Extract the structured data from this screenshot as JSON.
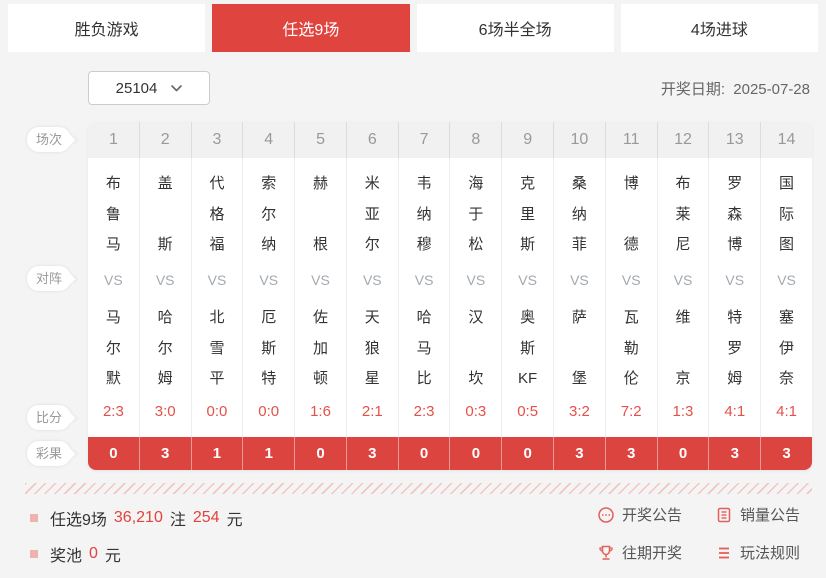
{
  "colors": {
    "accent_red": "#e0443e",
    "result_row_red": "#dc453f",
    "score_red": "#e4504a",
    "icon_red": "#e2605a",
    "page_bg": "#f4f4f4"
  },
  "tabs": [
    {
      "label": "胜负游戏",
      "active": false
    },
    {
      "label": "任选9场",
      "active": true
    },
    {
      "label": "6场半全场",
      "active": false
    },
    {
      "label": "4场进球",
      "active": false
    }
  ],
  "controls": {
    "period_value": "25104",
    "draw_date_label": "开奖日期:",
    "draw_date_value": "2025-07-28"
  },
  "row_labels": {
    "session": "场次",
    "matchup": "对阵",
    "score": "比分",
    "result": "彩果"
  },
  "table": {
    "vs_label": "VS"
  },
  "matches": [
    {
      "no": "1",
      "home": [
        "布",
        "鲁",
        "马"
      ],
      "away": [
        "马",
        "尔",
        "默"
      ],
      "score": "2:3",
      "result": "0"
    },
    {
      "no": "2",
      "home": [
        "盖",
        "斯"
      ],
      "away": [
        "哈",
        "尔",
        "姆"
      ],
      "score": "3:0",
      "result": "3"
    },
    {
      "no": "3",
      "home": [
        "代",
        "格",
        "福"
      ],
      "away": [
        "北",
        "雪",
        "平"
      ],
      "score": "0:0",
      "result": "1"
    },
    {
      "no": "4",
      "home": [
        "索",
        "尔",
        "纳"
      ],
      "away": [
        "厄",
        "斯",
        "特"
      ],
      "score": "0:0",
      "result": "1"
    },
    {
      "no": "5",
      "home": [
        "赫",
        "根"
      ],
      "away": [
        "佐",
        "加",
        "顿"
      ],
      "score": "1:6",
      "result": "0"
    },
    {
      "no": "6",
      "home": [
        "米",
        "亚",
        "尔"
      ],
      "away": [
        "天",
        "狼",
        "星"
      ],
      "score": "2:1",
      "result": "3"
    },
    {
      "no": "7",
      "home": [
        "韦",
        "纳",
        "穆"
      ],
      "away": [
        "哈",
        "马",
        "比"
      ],
      "score": "2:3",
      "result": "0"
    },
    {
      "no": "8",
      "home": [
        "海",
        "于",
        "松"
      ],
      "away": [
        "汉",
        "坎"
      ],
      "score": "0:3",
      "result": "0"
    },
    {
      "no": "9",
      "home": [
        "克",
        "里",
        "斯"
      ],
      "away": [
        "奥",
        "斯",
        "KF"
      ],
      "score": "0:5",
      "result": "0"
    },
    {
      "no": "10",
      "home": [
        "桑",
        "纳",
        "菲"
      ],
      "away": [
        "萨",
        "堡"
      ],
      "score": "3:2",
      "result": "3"
    },
    {
      "no": "11",
      "home": [
        "博",
        "德"
      ],
      "away": [
        "瓦",
        "勒",
        "伦"
      ],
      "score": "7:2",
      "result": "3"
    },
    {
      "no": "12",
      "home": [
        "布",
        "莱",
        "尼"
      ],
      "away": [
        "维",
        "京"
      ],
      "score": "1:3",
      "result": "0"
    },
    {
      "no": "13",
      "home": [
        "罗",
        "森",
        "博"
      ],
      "away": [
        "特",
        "罗",
        "姆"
      ],
      "score": "4:1",
      "result": "3"
    },
    {
      "no": "14",
      "home": [
        "国",
        "际",
        "图"
      ],
      "away": [
        "塞",
        "伊",
        "奈"
      ],
      "score": "4:1",
      "result": "3"
    }
  ],
  "summary": {
    "game_label": "任选9场",
    "bets_value": "36,210",
    "bets_unit": "注",
    "prize_value": "254",
    "prize_unit": "元",
    "pool_label": "奖池",
    "pool_value": "0",
    "pool_unit": "元"
  },
  "links": [
    {
      "id": "draw-announcement",
      "label": "开奖公告",
      "icon": "announcement-icon"
    },
    {
      "id": "sales-announcement",
      "label": "销量公告",
      "icon": "sales-icon"
    },
    {
      "id": "past-draws",
      "label": "往期开奖",
      "icon": "trophy-icon"
    },
    {
      "id": "game-rules",
      "label": "玩法规则",
      "icon": "rules-icon"
    }
  ]
}
